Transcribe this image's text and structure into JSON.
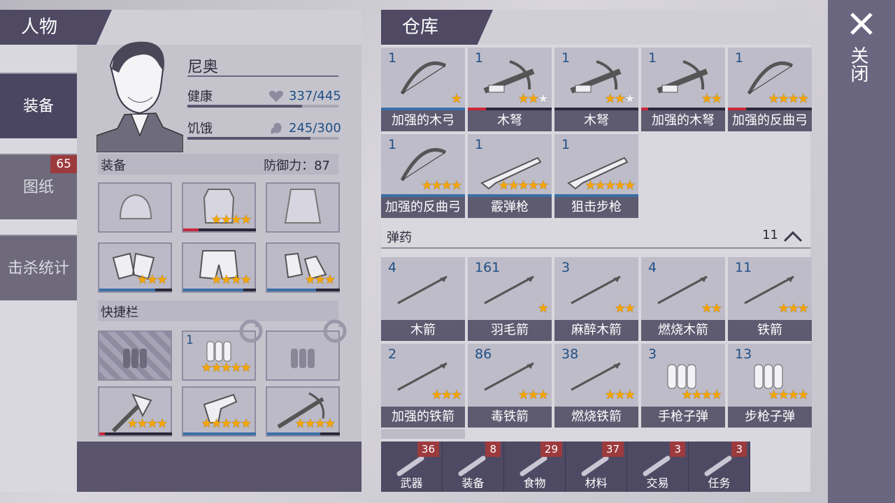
{
  "left_panel": {
    "tab_title": "人物",
    "nav": [
      {
        "label": "装备"
      },
      {
        "label": "图纸",
        "badge": "65"
      },
      {
        "label": "击杀统计"
      }
    ],
    "character": {
      "name": "尼奥",
      "health_label": "健康",
      "health_value": "337/445",
      "health_fraction": 0.757,
      "hunger_label": "饥饿",
      "hunger_value": "245/300",
      "hunger_fraction": 0.817
    },
    "equipment": {
      "section_label": "装备",
      "defense_label": "防御力：87"
    },
    "quickbar_label": "快捷栏",
    "quick_count": "1"
  },
  "warehouse": {
    "tab_title": "仓库",
    "items": [
      {
        "count": "1",
        "name": "加强的木弓",
        "icon": "bow-icon"
      },
      {
        "count": "1",
        "name": "木弩",
        "icon": "crossbow-icon"
      },
      {
        "count": "1",
        "name": "木弩",
        "icon": "crossbow-icon"
      },
      {
        "count": "1",
        "name": "加强的木弩",
        "icon": "crossbow-icon"
      },
      {
        "count": "1",
        "name": "加强的反曲弓",
        "icon": "recurve-bow-icon"
      },
      {
        "count": "1",
        "name": "加强的反曲弓",
        "icon": "recurve-bow-icon"
      },
      {
        "count": "1",
        "name": "霰弹枪",
        "icon": "shotgun-icon"
      },
      {
        "count": "1",
        "name": "狙击步枪",
        "icon": "sniper-rifle-icon"
      }
    ],
    "ammo_section": {
      "label": "弹药",
      "count": "11"
    },
    "ammo": [
      {
        "count": "4",
        "name": "木箭"
      },
      {
        "count": "161",
        "name": "羽毛箭"
      },
      {
        "count": "3",
        "name": "麻醉木箭"
      },
      {
        "count": "4",
        "name": "燃烧木箭"
      },
      {
        "count": "11",
        "name": "铁箭"
      },
      {
        "count": "2",
        "name": "加强的铁箭"
      },
      {
        "count": "86",
        "name": "毒铁箭"
      },
      {
        "count": "38",
        "name": "燃烧铁箭"
      },
      {
        "count": "3",
        "name": "手枪子弹"
      },
      {
        "count": "13",
        "name": "步枪子弹"
      }
    ],
    "categories": [
      {
        "label": "武器",
        "badge": "36",
        "icon": "hatchet-icon"
      },
      {
        "label": "装备",
        "badge": "8",
        "icon": "shirt-icon"
      },
      {
        "label": "食物",
        "badge": "29",
        "icon": "meat-icon"
      },
      {
        "label": "材料",
        "badge": "37",
        "icon": "log-icon"
      },
      {
        "label": "交易",
        "badge": "3",
        "icon": "coin-icon"
      },
      {
        "label": "任务",
        "badge": "3",
        "icon": "key-icon"
      }
    ]
  },
  "close": {
    "label": "关闭"
  },
  "colors": {
    "accent": "#4f4964",
    "star": "#f5a500",
    "count": "#1f4f86",
    "badge": "#9c3a3e"
  }
}
